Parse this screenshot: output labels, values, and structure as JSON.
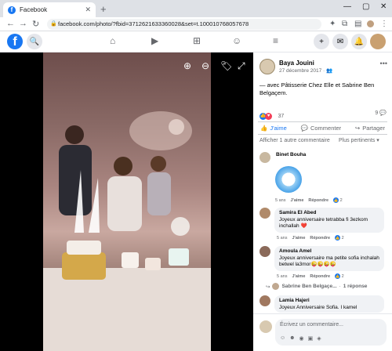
{
  "browser": {
    "tab_title": "Facebook",
    "tab_close": "✕",
    "new_tab": "+",
    "url": "facebook.com/photo/?fbid=3712621633360028&set=t.100010768057678",
    "win_min": "—",
    "win_max": "▢",
    "win_close": "✕"
  },
  "header": {
    "logo_letter": "f"
  },
  "post": {
    "author": "Baya Jouini",
    "date": "27 décembre 2017 · 👥",
    "more": "•••",
    "text": "— avec Pâtisserie Chez Elle et Sabrine Ben Belgaçem.",
    "reaction_count": "37",
    "comment_count": "9",
    "actions": {
      "like": "J'aime",
      "comment": "Commenter",
      "share": "Partager"
    },
    "more_comments": "Afficher 1 autre commentaire",
    "sort": "Plus pertinents ▾"
  },
  "comments": [
    {
      "name": "Binet Bouha",
      "time": "5 ans",
      "like": "J'aime",
      "reply": "Répondre",
      "count": "2"
    },
    {
      "name": "Samira El Abed",
      "text": "Joyeux anniversaire tetrabba fi 3ezkom inchallah ❤️",
      "time": "5 ans",
      "like": "J'aime",
      "reply": "Répondre",
      "count": "2"
    },
    {
      "name": "Amoula Amel",
      "text": "Joyeux anniversaire ma petite sofia inchalah betwel la3mor😜😜😜😜",
      "time": "5 ans",
      "like": "J'aime",
      "reply": "Répondre",
      "count": "2"
    },
    {
      "name": "Lamia Hajeri",
      "text": "Joyeux Anniversaire Sofia. I kamel"
    }
  ],
  "reply_summary": {
    "arrow": "↪",
    "name": "Sabrine Ben Belgaçe...",
    "dot": "·",
    "replies": "1 réponse"
  },
  "composer": {
    "placeholder": "Écrivez un commentaire..."
  }
}
